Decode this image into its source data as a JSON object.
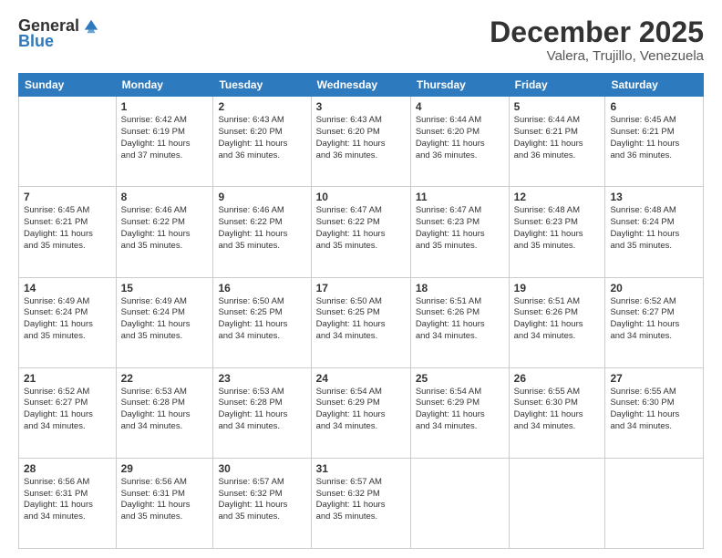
{
  "header": {
    "logo_general": "General",
    "logo_blue": "Blue",
    "month": "December 2025",
    "location": "Valera, Trujillo, Venezuela"
  },
  "weekdays": [
    "Sunday",
    "Monday",
    "Tuesday",
    "Wednesday",
    "Thursday",
    "Friday",
    "Saturday"
  ],
  "weeks": [
    [
      {
        "day": "",
        "info": ""
      },
      {
        "day": "1",
        "info": "Sunrise: 6:42 AM\nSunset: 6:19 PM\nDaylight: 11 hours\nand 37 minutes."
      },
      {
        "day": "2",
        "info": "Sunrise: 6:43 AM\nSunset: 6:20 PM\nDaylight: 11 hours\nand 36 minutes."
      },
      {
        "day": "3",
        "info": "Sunrise: 6:43 AM\nSunset: 6:20 PM\nDaylight: 11 hours\nand 36 minutes."
      },
      {
        "day": "4",
        "info": "Sunrise: 6:44 AM\nSunset: 6:20 PM\nDaylight: 11 hours\nand 36 minutes."
      },
      {
        "day": "5",
        "info": "Sunrise: 6:44 AM\nSunset: 6:21 PM\nDaylight: 11 hours\nand 36 minutes."
      },
      {
        "day": "6",
        "info": "Sunrise: 6:45 AM\nSunset: 6:21 PM\nDaylight: 11 hours\nand 36 minutes."
      }
    ],
    [
      {
        "day": "7",
        "info": "Sunrise: 6:45 AM\nSunset: 6:21 PM\nDaylight: 11 hours\nand 35 minutes."
      },
      {
        "day": "8",
        "info": "Sunrise: 6:46 AM\nSunset: 6:22 PM\nDaylight: 11 hours\nand 35 minutes."
      },
      {
        "day": "9",
        "info": "Sunrise: 6:46 AM\nSunset: 6:22 PM\nDaylight: 11 hours\nand 35 minutes."
      },
      {
        "day": "10",
        "info": "Sunrise: 6:47 AM\nSunset: 6:22 PM\nDaylight: 11 hours\nand 35 minutes."
      },
      {
        "day": "11",
        "info": "Sunrise: 6:47 AM\nSunset: 6:23 PM\nDaylight: 11 hours\nand 35 minutes."
      },
      {
        "day": "12",
        "info": "Sunrise: 6:48 AM\nSunset: 6:23 PM\nDaylight: 11 hours\nand 35 minutes."
      },
      {
        "day": "13",
        "info": "Sunrise: 6:48 AM\nSunset: 6:24 PM\nDaylight: 11 hours\nand 35 minutes."
      }
    ],
    [
      {
        "day": "14",
        "info": "Sunrise: 6:49 AM\nSunset: 6:24 PM\nDaylight: 11 hours\nand 35 minutes."
      },
      {
        "day": "15",
        "info": "Sunrise: 6:49 AM\nSunset: 6:24 PM\nDaylight: 11 hours\nand 35 minutes."
      },
      {
        "day": "16",
        "info": "Sunrise: 6:50 AM\nSunset: 6:25 PM\nDaylight: 11 hours\nand 34 minutes."
      },
      {
        "day": "17",
        "info": "Sunrise: 6:50 AM\nSunset: 6:25 PM\nDaylight: 11 hours\nand 34 minutes."
      },
      {
        "day": "18",
        "info": "Sunrise: 6:51 AM\nSunset: 6:26 PM\nDaylight: 11 hours\nand 34 minutes."
      },
      {
        "day": "19",
        "info": "Sunrise: 6:51 AM\nSunset: 6:26 PM\nDaylight: 11 hours\nand 34 minutes."
      },
      {
        "day": "20",
        "info": "Sunrise: 6:52 AM\nSunset: 6:27 PM\nDaylight: 11 hours\nand 34 minutes."
      }
    ],
    [
      {
        "day": "21",
        "info": "Sunrise: 6:52 AM\nSunset: 6:27 PM\nDaylight: 11 hours\nand 34 minutes."
      },
      {
        "day": "22",
        "info": "Sunrise: 6:53 AM\nSunset: 6:28 PM\nDaylight: 11 hours\nand 34 minutes."
      },
      {
        "day": "23",
        "info": "Sunrise: 6:53 AM\nSunset: 6:28 PM\nDaylight: 11 hours\nand 34 minutes."
      },
      {
        "day": "24",
        "info": "Sunrise: 6:54 AM\nSunset: 6:29 PM\nDaylight: 11 hours\nand 34 minutes."
      },
      {
        "day": "25",
        "info": "Sunrise: 6:54 AM\nSunset: 6:29 PM\nDaylight: 11 hours\nand 34 minutes."
      },
      {
        "day": "26",
        "info": "Sunrise: 6:55 AM\nSunset: 6:30 PM\nDaylight: 11 hours\nand 34 minutes."
      },
      {
        "day": "27",
        "info": "Sunrise: 6:55 AM\nSunset: 6:30 PM\nDaylight: 11 hours\nand 34 minutes."
      }
    ],
    [
      {
        "day": "28",
        "info": "Sunrise: 6:56 AM\nSunset: 6:31 PM\nDaylight: 11 hours\nand 34 minutes."
      },
      {
        "day": "29",
        "info": "Sunrise: 6:56 AM\nSunset: 6:31 PM\nDaylight: 11 hours\nand 35 minutes."
      },
      {
        "day": "30",
        "info": "Sunrise: 6:57 AM\nSunset: 6:32 PM\nDaylight: 11 hours\nand 35 minutes."
      },
      {
        "day": "31",
        "info": "Sunrise: 6:57 AM\nSunset: 6:32 PM\nDaylight: 11 hours\nand 35 minutes."
      },
      {
        "day": "",
        "info": ""
      },
      {
        "day": "",
        "info": ""
      },
      {
        "day": "",
        "info": ""
      }
    ]
  ]
}
